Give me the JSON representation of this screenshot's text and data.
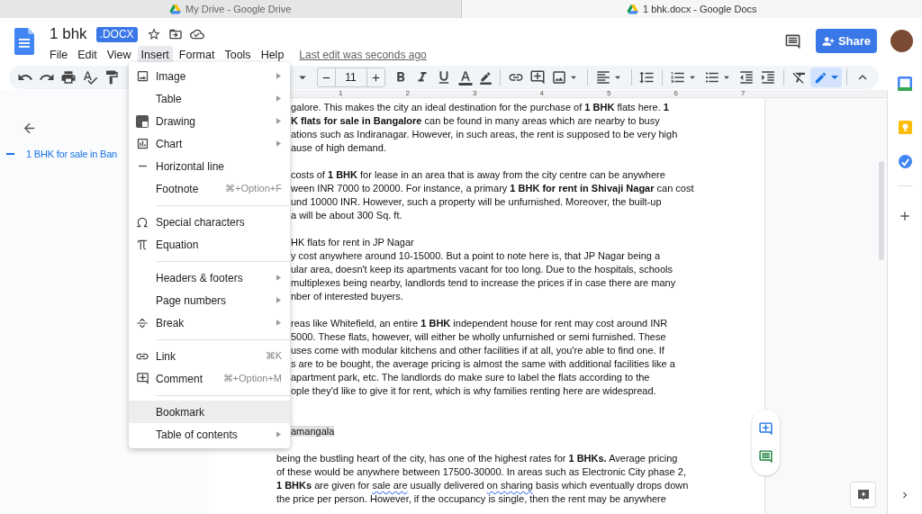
{
  "browser_tabs": [
    {
      "title": "My Drive - Google Drive",
      "selected": false
    },
    {
      "title": "1 bhk.docx - Google Docs",
      "selected": true
    }
  ],
  "document": {
    "title": "1 bhk",
    "format_badge": ".DOCX"
  },
  "menu_bar": [
    {
      "label": "File",
      "open": false
    },
    {
      "label": "Edit",
      "open": false
    },
    {
      "label": "View",
      "open": false
    },
    {
      "label": "Insert",
      "open": true
    },
    {
      "label": "Format",
      "open": false
    },
    {
      "label": "Tools",
      "open": false
    },
    {
      "label": "Help",
      "open": false
    }
  ],
  "last_edit": "Last edit was seconds ago",
  "share_button": "Share",
  "toolbar": {
    "font_size": "11"
  },
  "ruler": {
    "numbers": [
      "1",
      "2",
      "3",
      "4",
      "5",
      "6",
      "7"
    ]
  },
  "outline": {
    "headings": [
      {
        "text": "1 BHK for sale in Ban",
        "selected": true
      }
    ]
  },
  "insert_menu": [
    {
      "kind": "item",
      "label": "Image",
      "submenu": true,
      "highlighted": false
    },
    {
      "kind": "item",
      "label": "Table",
      "submenu": true,
      "highlighted": false
    },
    {
      "kind": "item",
      "label": "Drawing",
      "submenu": true,
      "highlighted": false
    },
    {
      "kind": "item",
      "label": "Chart",
      "submenu": true,
      "highlighted": false
    },
    {
      "kind": "item",
      "label": "Horizontal line",
      "submenu": false,
      "highlighted": false
    },
    {
      "kind": "item",
      "label": "Footnote",
      "shortcut": "⌘+Option+F",
      "submenu": false,
      "highlighted": false
    },
    {
      "kind": "separator"
    },
    {
      "kind": "item",
      "label": "Special characters",
      "submenu": false,
      "highlighted": false
    },
    {
      "kind": "item",
      "label": "Equation",
      "submenu": false,
      "highlighted": false
    },
    {
      "kind": "separator"
    },
    {
      "kind": "item",
      "label": "Headers & footers",
      "submenu": true,
      "highlighted": false
    },
    {
      "kind": "item",
      "label": "Page numbers",
      "submenu": true,
      "highlighted": false
    },
    {
      "kind": "item",
      "label": "Break",
      "submenu": true,
      "highlighted": false
    },
    {
      "kind": "separator"
    },
    {
      "kind": "item",
      "label": "Link",
      "shortcut": "⌘K",
      "submenu": false,
      "highlighted": false
    },
    {
      "kind": "item",
      "label": "Comment",
      "shortcut": "⌘+Option+M",
      "submenu": false,
      "highlighted": false
    },
    {
      "kind": "separator"
    },
    {
      "kind": "item",
      "label": "Bookmark",
      "submenu": false,
      "highlighted": true
    },
    {
      "kind": "item",
      "label": "Table of contents",
      "submenu": true,
      "highlighted": false
    }
  ],
  "body_lines": [
    {
      "kind": "partial",
      "segments": [
        {
          "kind": "plain",
          "text": "galore. This makes the city an ideal destination for the purchase of "
        },
        {
          "kind": "bold",
          "text": "1 BHK"
        },
        {
          "kind": "plain",
          "text": " flats here. "
        },
        {
          "kind": "bold",
          "text": "1"
        }
      ]
    },
    {
      "kind": "partial",
      "segments": [
        {
          "kind": "bold",
          "text": "K flats for sale in Bangalore"
        },
        {
          "kind": "plain",
          "text": " can be found in many areas which are nearby to busy"
        }
      ]
    },
    {
      "kind": "partial",
      "segments": [
        {
          "kind": "plain",
          "text": "ations such as Indiranagar. However, in such areas, the rent is supposed to be very high"
        }
      ]
    },
    {
      "kind": "partial",
      "segments": [
        {
          "kind": "plain",
          "text": "ause of high demand."
        }
      ]
    },
    {
      "kind": "blank"
    },
    {
      "kind": "partial",
      "segments": [
        {
          "kind": "plain",
          "text": "costs of "
        },
        {
          "kind": "bold",
          "text": "1 BHK"
        },
        {
          "kind": "plain",
          "text": " for lease in an area that is away from the city centre can be anywhere"
        }
      ]
    },
    {
      "kind": "partial",
      "segments": [
        {
          "kind": "plain",
          "text": "ween INR 7000 to 20000. For instance, a primary "
        },
        {
          "kind": "bold",
          "text": "1 BHK for rent in Shivaji Nagar"
        },
        {
          "kind": "plain",
          "text": " can cost"
        }
      ]
    },
    {
      "kind": "partial",
      "segments": [
        {
          "kind": "plain",
          "text": "und 10000 INR. However, such a property will be unfurnished. Moreover, the built-up"
        }
      ]
    },
    {
      "kind": "partial",
      "segments": [
        {
          "kind": "plain",
          "text": "a will be about 300 Sq. ft."
        }
      ]
    },
    {
      "kind": "blank"
    },
    {
      "kind": "partial",
      "segments": [
        {
          "kind": "plain",
          "text": "HK flats for rent in JP Nagar"
        }
      ]
    },
    {
      "kind": "partial",
      "segments": [
        {
          "kind": "plain",
          "text": "y cost anywhere around 10-15000. But a point to note here is, that JP Nagar being a"
        }
      ]
    },
    {
      "kind": "partial",
      "segments": [
        {
          "kind": "plain",
          "text": "ular area, doesn't keep its apartments vacant for too long. Due to the hospitals, schools"
        }
      ]
    },
    {
      "kind": "partial",
      "segments": [
        {
          "kind": "plain",
          "text": "multiplexes being nearby, landlords tend to increase the prices if in case there are many"
        }
      ]
    },
    {
      "kind": "partial",
      "segments": [
        {
          "kind": "plain",
          "text": "nber of interested buyers."
        }
      ]
    },
    {
      "kind": "blank"
    },
    {
      "kind": "partial",
      "segments": [
        {
          "kind": "plain",
          "text": "reas like Whitefield, an entire "
        },
        {
          "kind": "bold",
          "text": "1 BHK"
        },
        {
          "kind": "plain",
          "text": " independent house for rent may cost around INR"
        }
      ]
    },
    {
      "kind": "partial",
      "segments": [
        {
          "kind": "plain",
          "text": "5000. These flats, however, will either be wholly unfurnished or semi furnished. These"
        }
      ]
    },
    {
      "kind": "partial",
      "segments": [
        {
          "kind": "plain",
          "text": "uses come with modular kitchens and other facilities if at all, you're able to find one. If"
        }
      ]
    },
    {
      "kind": "partial",
      "segments": [
        {
          "kind": "plain",
          "text": "s are to be bought, the average pricing is almost the same with additional facilities like a"
        }
      ]
    },
    {
      "kind": "partial",
      "segments": [
        {
          "kind": "plain",
          "text": "apartment park, etc. The landlords do make sure to label the flats according to the"
        }
      ]
    },
    {
      "kind": "partial",
      "segments": [
        {
          "kind": "plain",
          "text": "ople they'd like to give it for rent, which is why families renting here are widespread."
        }
      ]
    },
    {
      "kind": "blank"
    },
    {
      "kind": "blank"
    },
    {
      "kind": "partial",
      "segments": [
        {
          "kind": "highlight",
          "text": "amangala"
        }
      ]
    },
    {
      "kind": "blank"
    },
    {
      "kind": "full",
      "segments": [
        {
          "kind": "plain",
          "text": "being the bustling heart of the city, has one of the highest rates for "
        },
        {
          "kind": "bold",
          "text": "1 BHKs."
        },
        {
          "kind": "plain",
          "text": " Average pricing"
        }
      ]
    },
    {
      "kind": "full",
      "segments": [
        {
          "kind": "plain",
          "text": "of these would be anywhere between 17500-30000. In areas such as Electronic City phase 2,"
        }
      ]
    },
    {
      "kind": "full",
      "segments": [
        {
          "kind": "bold",
          "text": "1 BHKs"
        },
        {
          "kind": "plain",
          "text": " are given for "
        },
        {
          "kind": "spelling",
          "text": "sale are"
        },
        {
          "kind": "plain",
          "text": " usually delivered "
        },
        {
          "kind": "spelling",
          "text": "on sharing"
        },
        {
          "kind": "plain",
          "text": " basis which eventually drops down"
        }
      ]
    },
    {
      "kind": "full",
      "segments": [
        {
          "kind": "plain",
          "text": "the price per person. However, if the occupancy is single, then the rent may be anywhere"
        }
      ]
    }
  ]
}
